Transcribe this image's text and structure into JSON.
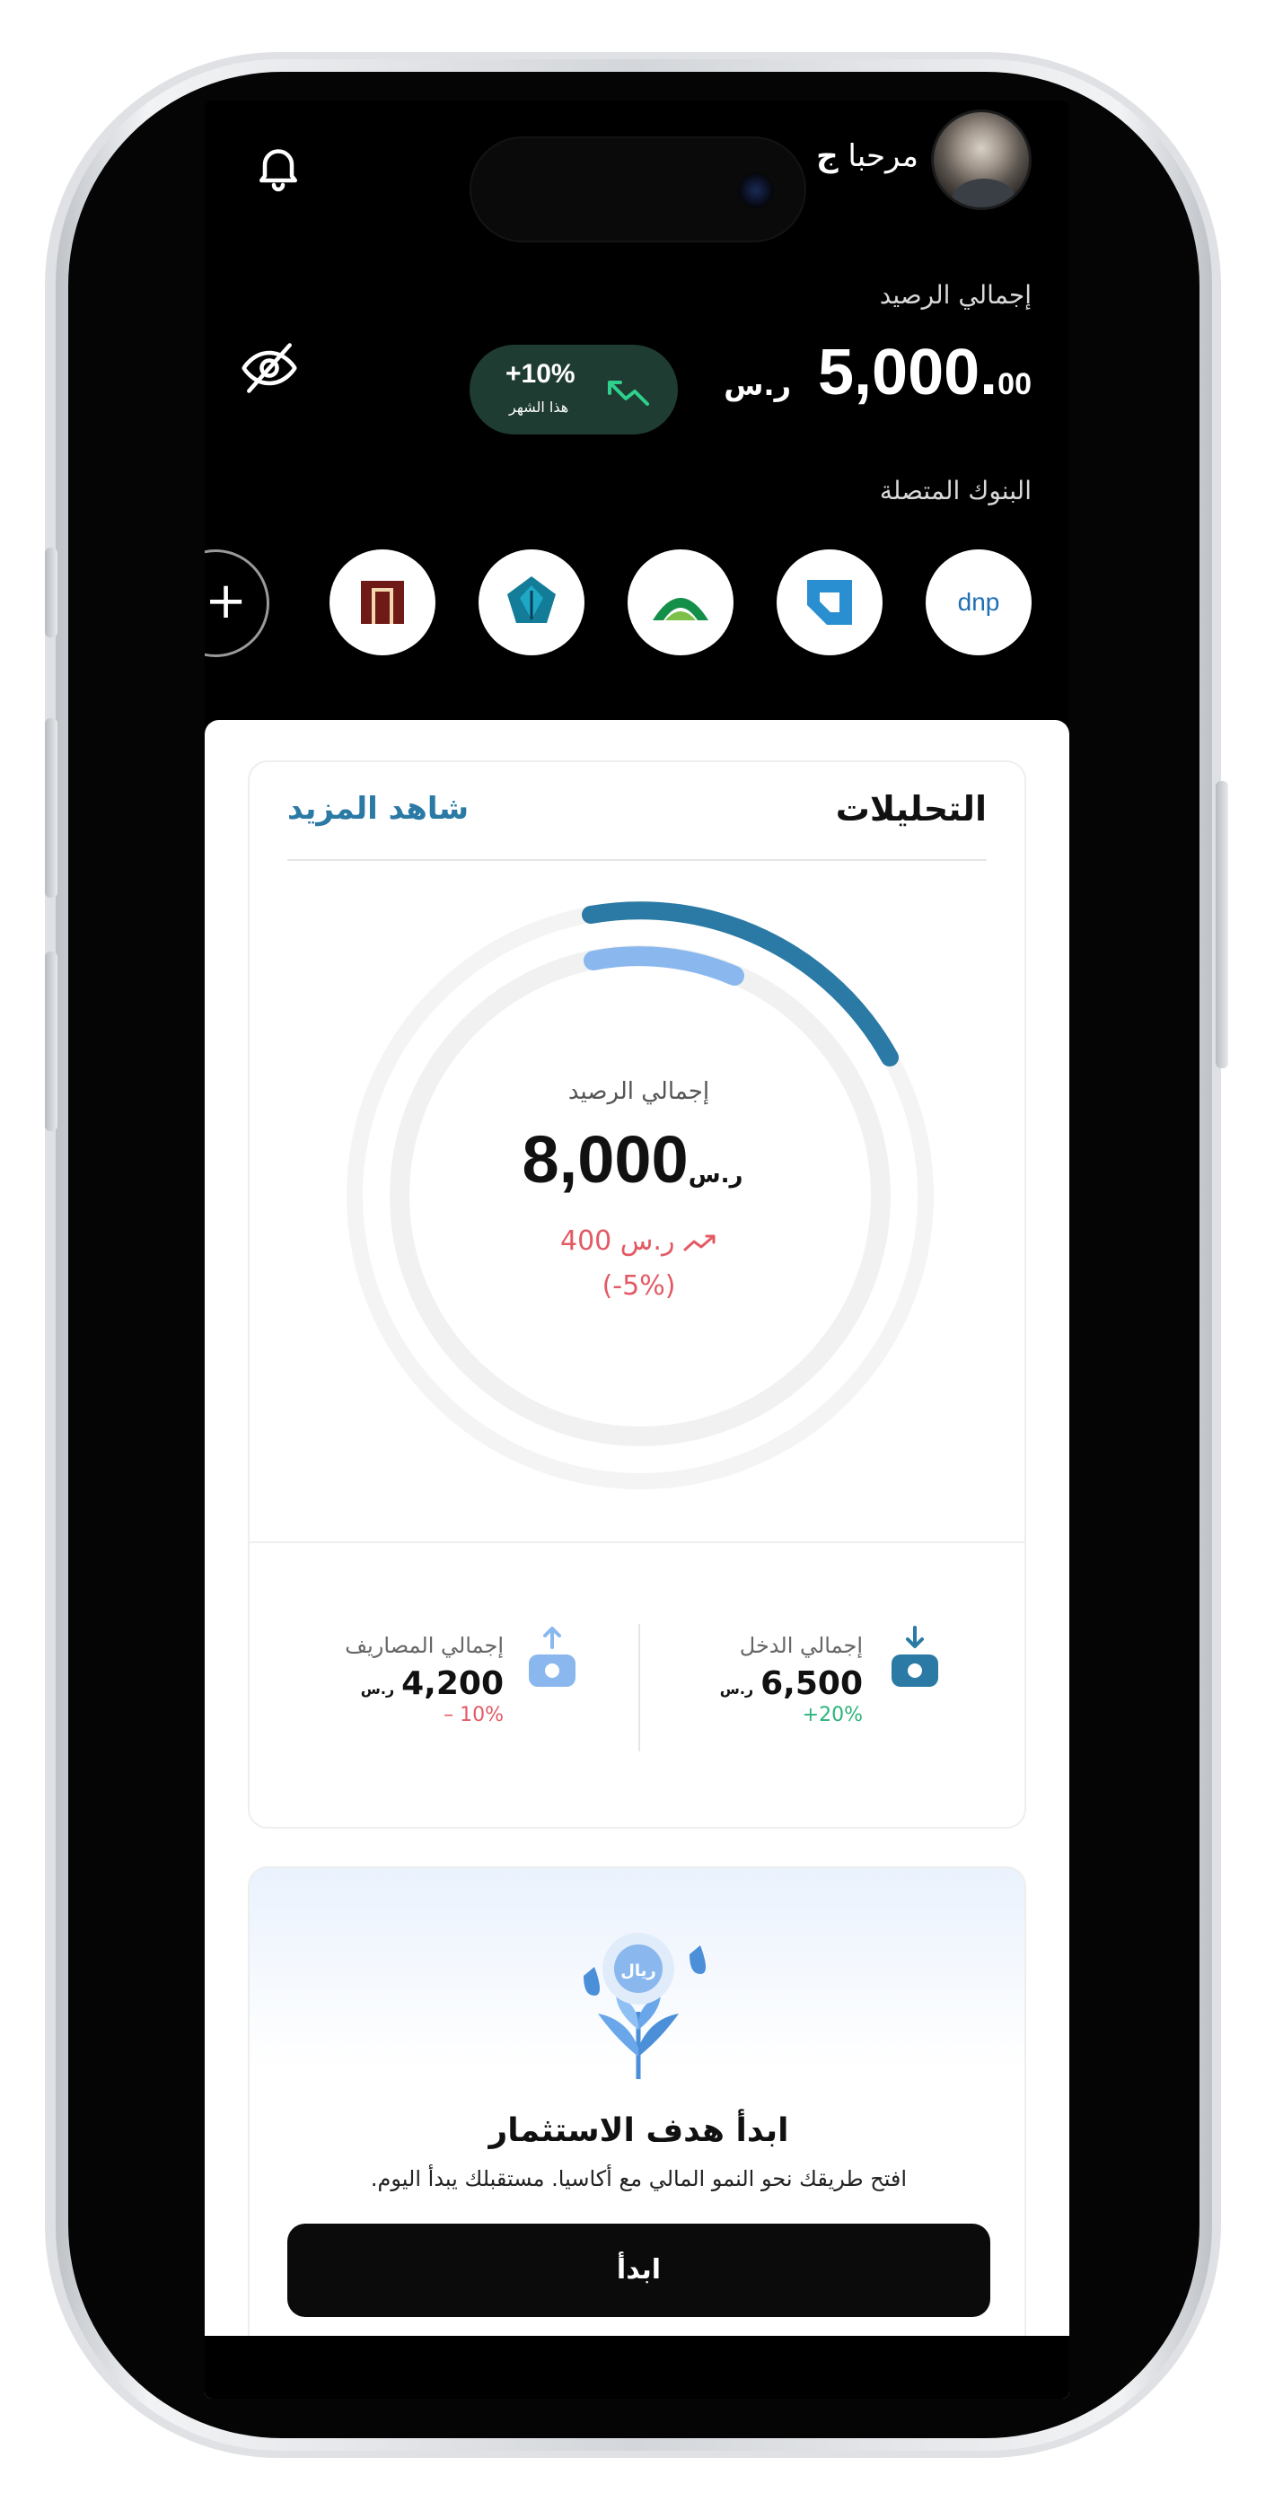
{
  "header": {
    "greeting_prefix": "مرحبا",
    "greeting_name": "ج",
    "balance_label": "إجمالي الرصيد",
    "balance_whole": "5,000.",
    "balance_fraction": "00",
    "currency": "ر.س",
    "change_percent": "+10%",
    "change_period": "هذا الشهر",
    "icons": {
      "notifications": "bell-icon",
      "hide_balance": "eye-off-icon",
      "trend": "trend-up-icon"
    }
  },
  "banks": {
    "label": "البنوك المتصلة",
    "add_label": "+",
    "items": [
      {
        "name": "dnp-logo",
        "text": "dnp",
        "color": "#1e6fb5"
      },
      {
        "name": "blue-square-logo",
        "color": "#2a8fd0"
      },
      {
        "name": "green-arch-logo",
        "color": "#138f4a"
      },
      {
        "name": "teal-crest-logo",
        "color": "#137c99"
      },
      {
        "name": "maroon-door-logo",
        "color": "#6f1a17"
      }
    ]
  },
  "analytics": {
    "title": "التحليلات",
    "see_more": "شاهد المزيد",
    "total_label": "إجمالي الرصيد",
    "total_value": "8,000",
    "currency": "ر.س",
    "change_value": "400 ر.س",
    "change_percent": "(-5%)",
    "income": {
      "label": "إجمالي الدخل",
      "value": "6,500",
      "currency": "ر.س",
      "change": "20%+",
      "change_color": "#2db37a"
    },
    "expenses": {
      "label": "إجمالي المصاريف",
      "value": "4,200",
      "currency": "ر.س",
      "change": "10% –",
      "change_color": "#e35a64"
    }
  },
  "investment": {
    "coin_label": "ريال",
    "title": "ابدأ هدف الاستثمار",
    "description": "افتح طريقك نحو النمو المالي مع أكاسيا. مستقبلك يبدأ اليوم.",
    "button_label": "ابدأ"
  },
  "colors": {
    "accent_blue": "#2a7aa5",
    "light_blue": "#8ab8ee",
    "positive": "#2db37a",
    "negative": "#e35a64",
    "pill_bg": "#1f3c33"
  }
}
